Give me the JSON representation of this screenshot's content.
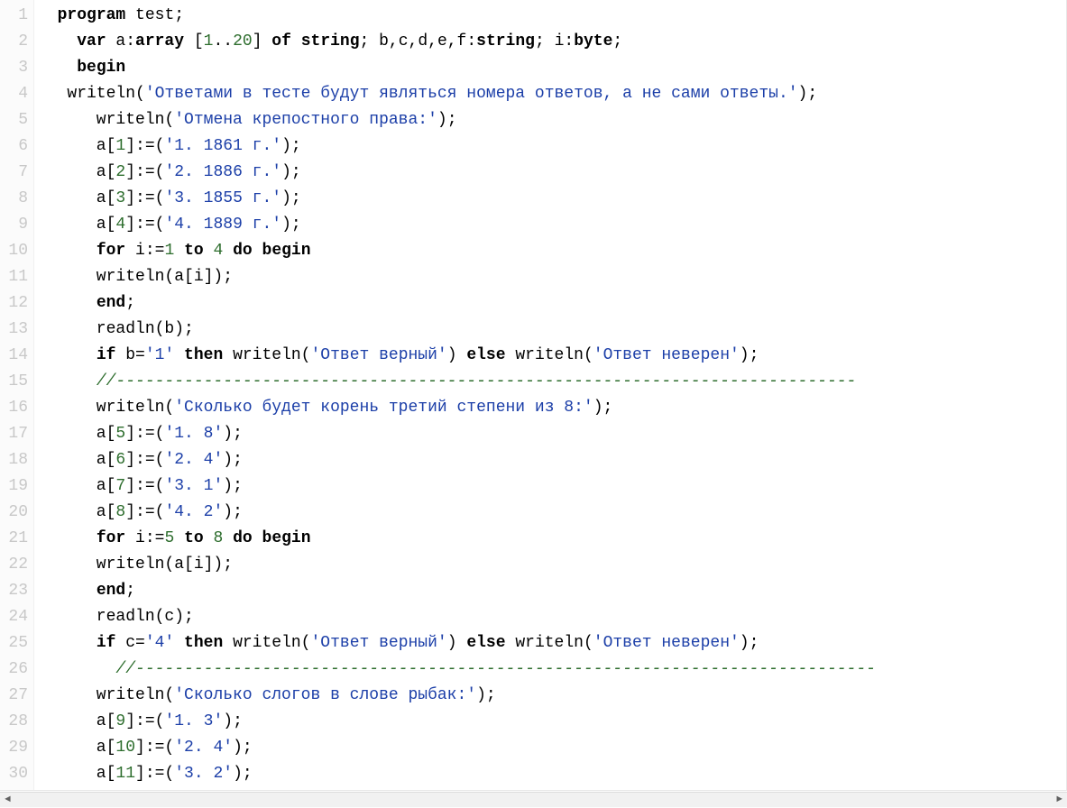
{
  "lines": [
    {
      "n": "1",
      "segs": [
        {
          "t": "  "
        },
        {
          "t": "program",
          "c": "kw"
        },
        {
          "t": " test;"
        }
      ]
    },
    {
      "n": "2",
      "segs": [
        {
          "t": "    "
        },
        {
          "t": "var",
          "c": "kw"
        },
        {
          "t": " a:"
        },
        {
          "t": "array",
          "c": "kw"
        },
        {
          "t": " ["
        },
        {
          "t": "1",
          "c": "num"
        },
        {
          "t": ".."
        },
        {
          "t": "20",
          "c": "num"
        },
        {
          "t": "] "
        },
        {
          "t": "of",
          "c": "kw"
        },
        {
          "t": " "
        },
        {
          "t": "string",
          "c": "kw"
        },
        {
          "t": "; b,c,d,e,f:"
        },
        {
          "t": "string",
          "c": "kw"
        },
        {
          "t": "; i:"
        },
        {
          "t": "byte",
          "c": "kw"
        },
        {
          "t": ";"
        }
      ]
    },
    {
      "n": "3",
      "segs": [
        {
          "t": "    "
        },
        {
          "t": "begin",
          "c": "kw"
        }
      ]
    },
    {
      "n": "4",
      "segs": [
        {
          "t": "   writeln("
        },
        {
          "t": "'Ответами в тесте будут являться номера ответов, а не сами ответы.'",
          "c": "str"
        },
        {
          "t": ");"
        }
      ]
    },
    {
      "n": "5",
      "segs": [
        {
          "t": "      writeln("
        },
        {
          "t": "'Отмена крепостного права:'",
          "c": "str"
        },
        {
          "t": ");"
        }
      ]
    },
    {
      "n": "6",
      "segs": [
        {
          "t": "      a["
        },
        {
          "t": "1",
          "c": "num"
        },
        {
          "t": "]:=("
        },
        {
          "t": "'1. 1861 г.'",
          "c": "str"
        },
        {
          "t": ");"
        }
      ]
    },
    {
      "n": "7",
      "segs": [
        {
          "t": "      a["
        },
        {
          "t": "2",
          "c": "num"
        },
        {
          "t": "]:=("
        },
        {
          "t": "'2. 1886 г.'",
          "c": "str"
        },
        {
          "t": ");"
        }
      ]
    },
    {
      "n": "8",
      "segs": [
        {
          "t": "      a["
        },
        {
          "t": "3",
          "c": "num"
        },
        {
          "t": "]:=("
        },
        {
          "t": "'3. 1855 г.'",
          "c": "str"
        },
        {
          "t": ");"
        }
      ]
    },
    {
      "n": "9",
      "segs": [
        {
          "t": "      a["
        },
        {
          "t": "4",
          "c": "num"
        },
        {
          "t": "]:=("
        },
        {
          "t": "'4. 1889 г.'",
          "c": "str"
        },
        {
          "t": ");"
        }
      ]
    },
    {
      "n": "10",
      "segs": [
        {
          "t": "      "
        },
        {
          "t": "for",
          "c": "kw"
        },
        {
          "t": " i:="
        },
        {
          "t": "1",
          "c": "num"
        },
        {
          "t": " "
        },
        {
          "t": "to",
          "c": "kw"
        },
        {
          "t": " "
        },
        {
          "t": "4",
          "c": "num"
        },
        {
          "t": " "
        },
        {
          "t": "do",
          "c": "kw"
        },
        {
          "t": " "
        },
        {
          "t": "begin",
          "c": "kw"
        }
      ]
    },
    {
      "n": "11",
      "segs": [
        {
          "t": "      writeln(a[i]);"
        }
      ]
    },
    {
      "n": "12",
      "segs": [
        {
          "t": "      "
        },
        {
          "t": "end",
          "c": "kw"
        },
        {
          "t": ";"
        }
      ]
    },
    {
      "n": "13",
      "segs": [
        {
          "t": "      readln(b);"
        }
      ]
    },
    {
      "n": "14",
      "segs": [
        {
          "t": "      "
        },
        {
          "t": "if",
          "c": "kw"
        },
        {
          "t": " b="
        },
        {
          "t": "'1'",
          "c": "str"
        },
        {
          "t": " "
        },
        {
          "t": "then",
          "c": "kw"
        },
        {
          "t": " writeln("
        },
        {
          "t": "'Ответ верный'",
          "c": "str"
        },
        {
          "t": ") "
        },
        {
          "t": "else",
          "c": "kw"
        },
        {
          "t": " writeln("
        },
        {
          "t": "'Ответ неверен'",
          "c": "str"
        },
        {
          "t": ");"
        }
      ]
    },
    {
      "n": "15",
      "segs": [
        {
          "t": "      "
        },
        {
          "t": "//----------------------------------------------------------------------------",
          "c": "cmt"
        }
      ]
    },
    {
      "n": "16",
      "segs": [
        {
          "t": "      writeln("
        },
        {
          "t": "'Сколько будет корень третий степени из 8:'",
          "c": "str"
        },
        {
          "t": ");"
        }
      ]
    },
    {
      "n": "17",
      "segs": [
        {
          "t": "      a["
        },
        {
          "t": "5",
          "c": "num"
        },
        {
          "t": "]:=("
        },
        {
          "t": "'1. 8'",
          "c": "str"
        },
        {
          "t": ");"
        }
      ]
    },
    {
      "n": "18",
      "segs": [
        {
          "t": "      a["
        },
        {
          "t": "6",
          "c": "num"
        },
        {
          "t": "]:=("
        },
        {
          "t": "'2. 4'",
          "c": "str"
        },
        {
          "t": ");"
        }
      ]
    },
    {
      "n": "19",
      "segs": [
        {
          "t": "      a["
        },
        {
          "t": "7",
          "c": "num"
        },
        {
          "t": "]:=("
        },
        {
          "t": "'3. 1'",
          "c": "str"
        },
        {
          "t": ");"
        }
      ]
    },
    {
      "n": "20",
      "segs": [
        {
          "t": "      a["
        },
        {
          "t": "8",
          "c": "num"
        },
        {
          "t": "]:=("
        },
        {
          "t": "'4. 2'",
          "c": "str"
        },
        {
          "t": ");"
        }
      ]
    },
    {
      "n": "21",
      "segs": [
        {
          "t": "      "
        },
        {
          "t": "for",
          "c": "kw"
        },
        {
          "t": " i:="
        },
        {
          "t": "5",
          "c": "num"
        },
        {
          "t": " "
        },
        {
          "t": "to",
          "c": "kw"
        },
        {
          "t": " "
        },
        {
          "t": "8",
          "c": "num"
        },
        {
          "t": " "
        },
        {
          "t": "do",
          "c": "kw"
        },
        {
          "t": " "
        },
        {
          "t": "begin",
          "c": "kw"
        }
      ]
    },
    {
      "n": "22",
      "segs": [
        {
          "t": "      writeln(a[i]);"
        }
      ]
    },
    {
      "n": "23",
      "segs": [
        {
          "t": "      "
        },
        {
          "t": "end",
          "c": "kw"
        },
        {
          "t": ";"
        }
      ]
    },
    {
      "n": "24",
      "segs": [
        {
          "t": "      readln(c);"
        }
      ]
    },
    {
      "n": "25",
      "segs": [
        {
          "t": "      "
        },
        {
          "t": "if",
          "c": "kw"
        },
        {
          "t": " c="
        },
        {
          "t": "'4'",
          "c": "str"
        },
        {
          "t": " "
        },
        {
          "t": "then",
          "c": "kw"
        },
        {
          "t": " writeln("
        },
        {
          "t": "'Ответ верный'",
          "c": "str"
        },
        {
          "t": ") "
        },
        {
          "t": "else",
          "c": "kw"
        },
        {
          "t": " writeln("
        },
        {
          "t": "'Ответ неверен'",
          "c": "str"
        },
        {
          "t": ");"
        }
      ]
    },
    {
      "n": "26",
      "segs": [
        {
          "t": "        "
        },
        {
          "t": "//----------------------------------------------------------------------------",
          "c": "cmt"
        }
      ]
    },
    {
      "n": "27",
      "segs": [
        {
          "t": "      writeln("
        },
        {
          "t": "'Сколько слогов в слове рыбак:'",
          "c": "str"
        },
        {
          "t": ");"
        }
      ]
    },
    {
      "n": "28",
      "segs": [
        {
          "t": "      a["
        },
        {
          "t": "9",
          "c": "num"
        },
        {
          "t": "]:=("
        },
        {
          "t": "'1. 3'",
          "c": "str"
        },
        {
          "t": ");"
        }
      ]
    },
    {
      "n": "29",
      "segs": [
        {
          "t": "      a["
        },
        {
          "t": "10",
          "c": "num"
        },
        {
          "t": "]:=("
        },
        {
          "t": "'2. 4'",
          "c": "str"
        },
        {
          "t": ");"
        }
      ]
    },
    {
      "n": "30",
      "segs": [
        {
          "t": "      a["
        },
        {
          "t": "11",
          "c": "num"
        },
        {
          "t": "]:=("
        },
        {
          "t": "'3. 2'",
          "c": "str"
        },
        {
          "t": ");"
        }
      ]
    }
  ],
  "scroll": {
    "left": "◄",
    "right": "►"
  }
}
